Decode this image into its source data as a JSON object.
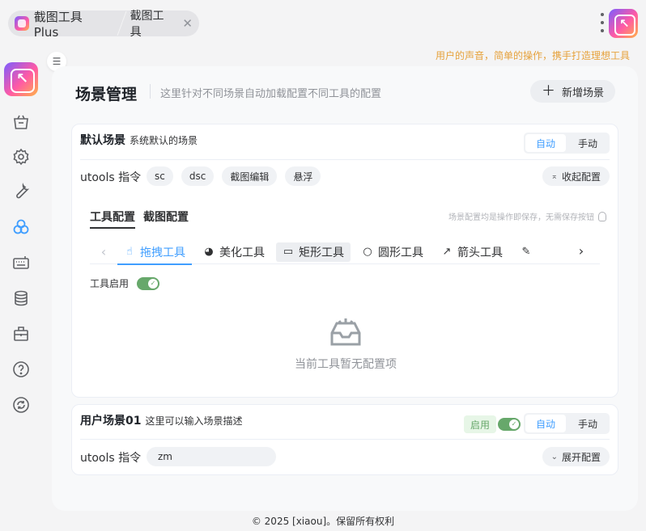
{
  "app": {
    "tab_main": "截图工具 Plus",
    "tab_sub": "截图工具",
    "slogan": "用户的声音，简单的操作，携手打造理想工具"
  },
  "sidebar": {
    "items": [
      {
        "icon": "bag-icon"
      },
      {
        "icon": "gear-icon"
      },
      {
        "icon": "wrench-icon"
      },
      {
        "icon": "circles-icon",
        "active": true
      },
      {
        "icon": "keyboard-icon"
      },
      {
        "icon": "database-icon"
      },
      {
        "icon": "toolbox-icon"
      },
      {
        "icon": "help-icon"
      },
      {
        "icon": "refresh-icon"
      }
    ]
  },
  "page": {
    "title": "场景管理",
    "description": "这里针对不同场景自动加载配置不同工具的配置",
    "add_button": "新增场景"
  },
  "default_scene": {
    "name": "默认场景",
    "description": "系统默认的场景",
    "mode_auto": "自动",
    "mode_manual": "手动",
    "cmd_label": "utools 指令",
    "commands": [
      "sc",
      "dsc",
      "截图编辑",
      "悬浮"
    ],
    "collapse_button": "收起配置",
    "tabs": [
      "工具配置",
      "截图配置"
    ],
    "save_hint": "场景配置均是操作即保存，无需保存按钮",
    "tools": [
      "拖拽工具",
      "美化工具",
      "矩形工具",
      "圆形工具",
      "箭头工具"
    ],
    "enable_label": "工具启用",
    "empty_text": "当前工具暂无配置项"
  },
  "user_scene": {
    "name": "用户场景01",
    "description": "这里可以输入场景描述",
    "enabled_badge": "启用",
    "mode_auto": "自动",
    "mode_manual": "手动",
    "cmd_label": "utools 指令",
    "command_value": "zm",
    "expand_button": "展开配置"
  },
  "footer": "© 2025 [xiaou]。保留所有权利",
  "colors": {
    "accent": "#409eff",
    "success": "#67a86b",
    "slogan": "#e6a23c"
  }
}
